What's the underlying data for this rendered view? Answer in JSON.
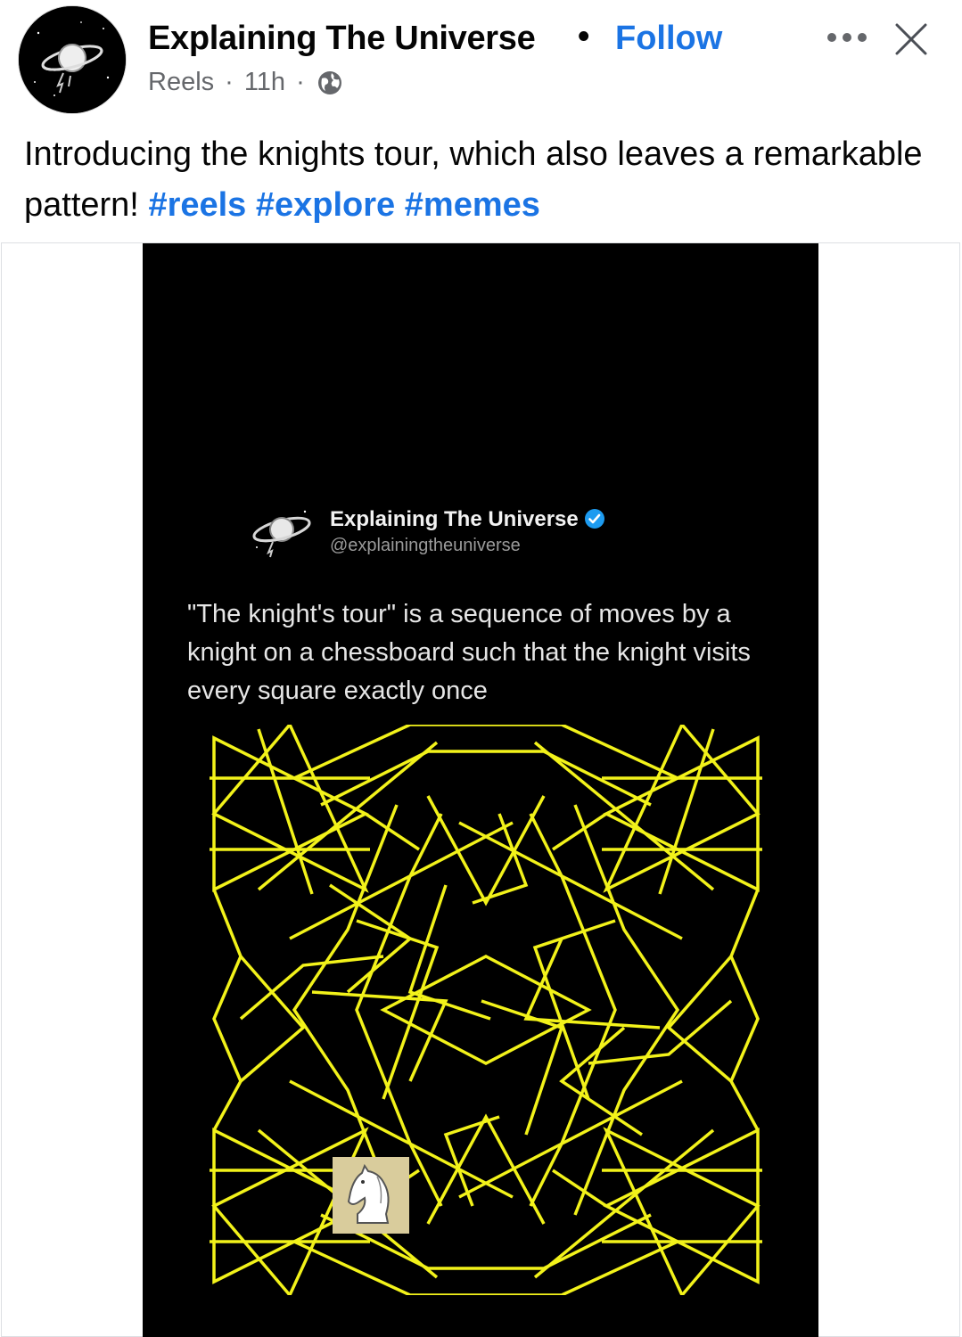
{
  "post": {
    "page_name": "Explaining The Universe",
    "separator": "•",
    "follow_label": "Follow",
    "meta_source": "Reels",
    "meta_time": "11h",
    "meta_dot": "·",
    "privacy_icon": "globe-icon",
    "more_icon": "more-options-icon",
    "close_icon": "close-icon",
    "caption_text": "Introducing the knights tour, which also leaves a remarkable pattern!",
    "hashtags": [
      "#reels",
      "#explore",
      "#memes"
    ]
  },
  "reel": {
    "account_name": "Explaining The Universe",
    "account_handle": "@explainingtheuniverse",
    "verified_icon": "verified-badge-icon",
    "body_text": "\"The knight's tour\" is a sequence of moves by a knight on a chessboard such that the knight visits every square exactly once",
    "pattern_color": "#f2f21a",
    "knight_square_color": "#d9cc9c"
  },
  "colors": {
    "link_blue": "#1b74e4",
    "text_primary": "#050505",
    "text_secondary": "#65676b",
    "video_bg": "#000000"
  }
}
